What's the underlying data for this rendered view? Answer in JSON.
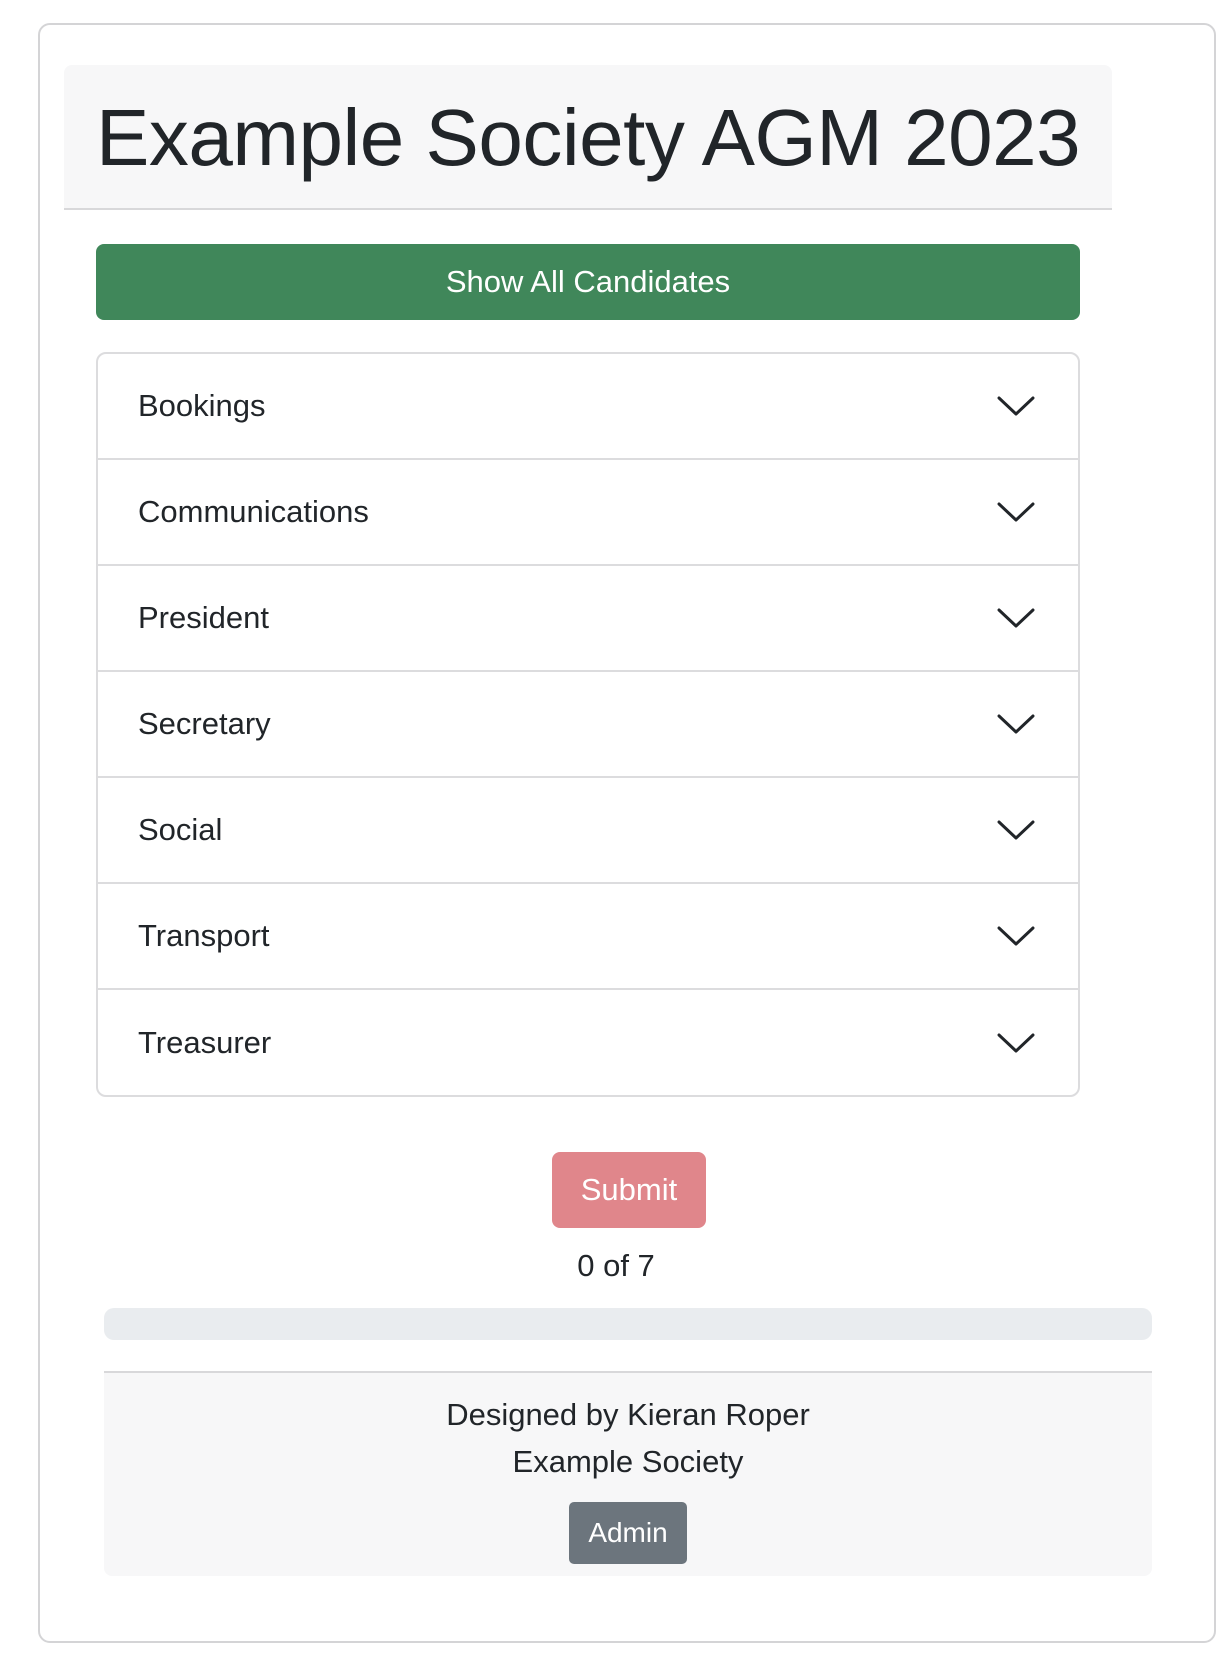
{
  "header": {
    "title": "Example Society AGM 2023"
  },
  "toolbar": {
    "show_all_label": "Show All Candidates"
  },
  "positions": [
    {
      "label": "Bookings",
      "icon": "chevron-down-icon"
    },
    {
      "label": "Communications",
      "icon": "chevron-down-icon"
    },
    {
      "label": "President",
      "icon": "chevron-down-icon"
    },
    {
      "label": "Secretary",
      "icon": "chevron-down-icon"
    },
    {
      "label": "Social",
      "icon": "chevron-down-icon"
    },
    {
      "label": "Transport",
      "icon": "chevron-down-icon"
    },
    {
      "label": "Treasurer",
      "icon": "chevron-down-icon"
    }
  ],
  "submit": {
    "label": "Submit"
  },
  "progress": {
    "text": "0 of 7",
    "completed": 0,
    "total": 7
  },
  "footer": {
    "credit": "Designed by Kieran Roper",
    "organization": "Example Society",
    "admin_label": "Admin"
  },
  "colors": {
    "show_all_button": "#40875a",
    "submit_button": "#e0868b",
    "admin_button": "#6c757d",
    "progress_track": "#e9ecef",
    "header_background": "#f7f7f8"
  }
}
